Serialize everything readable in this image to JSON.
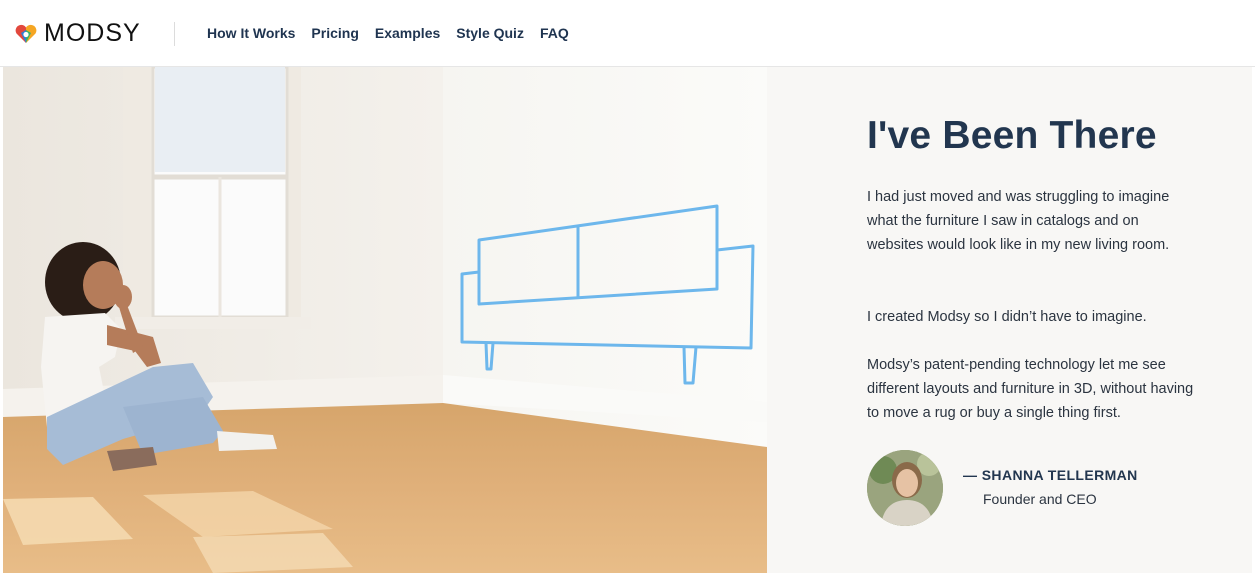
{
  "header": {
    "logo_text": "MODSY",
    "nav": [
      "How It Works",
      "Pricing",
      "Examples",
      "Style Quiz",
      "FAQ"
    ]
  },
  "panel": {
    "title": "I've Been There",
    "paragraphs": [
      "I had just moved and was struggling to imagine what the furniture I saw in catalogs and on websites would look like in my new living room.",
      "I created Modsy so I didn’t have to imagine.",
      "Modsy’s patent-pending technology let me see different layouts and furniture in 3D, without having to move a rug or buy a single thing first."
    ],
    "signature": {
      "name": "— SHANNA TELLERMAN",
      "role": "Founder and CEO"
    }
  },
  "colors": {
    "brand_navy": "#22364f",
    "sofa_sketch": "#6db7ec",
    "panel_bg": "#f8f7f5"
  },
  "icons": [
    "modsy-heart-logo-icon"
  ]
}
